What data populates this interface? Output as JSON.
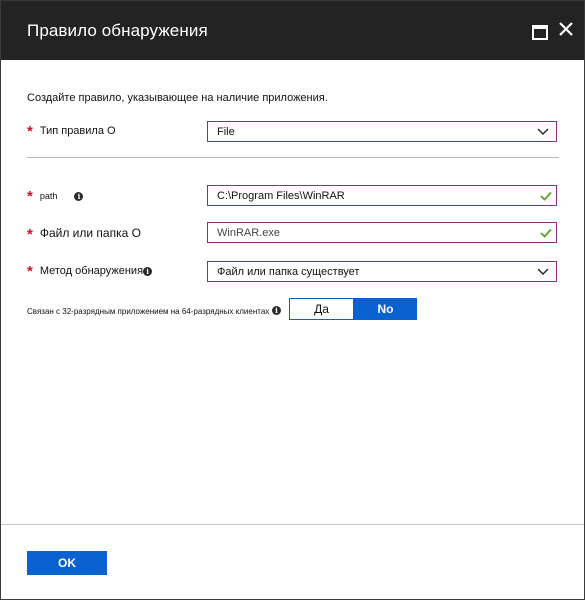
{
  "window": {
    "title": "Правило обнаружения"
  },
  "intro": "Создайте правило, указывающее на наличие приложения.",
  "rule_type": {
    "label": "Тип правила О",
    "value": "File"
  },
  "path": {
    "label": "path",
    "value": "C:\\Program Files\\WinRAR"
  },
  "file_or_folder": {
    "label": "Файл или папка О",
    "value": "WinRAR.exe"
  },
  "detection_method": {
    "label": "Метод обнаружения",
    "value": "Файл или папка существует"
  },
  "bitness": {
    "label": "Связан с 32-разрядным приложением на 64-разрядных клиентах",
    "options": [
      "Да",
      "No"
    ],
    "selected": "No"
  },
  "footer": {
    "ok_label": "OK"
  },
  "colors": {
    "accent": "#0a62d0",
    "titlebar": "#232323",
    "required": "#d0102a",
    "valid_check": "#5aa028",
    "field_border": "#8a2d83"
  },
  "icons": {
    "maximize": "maximize-icon",
    "close": "close-icon",
    "info": "info-icon",
    "dropdown": "chevron-down-icon",
    "valid": "checkmark-icon"
  }
}
